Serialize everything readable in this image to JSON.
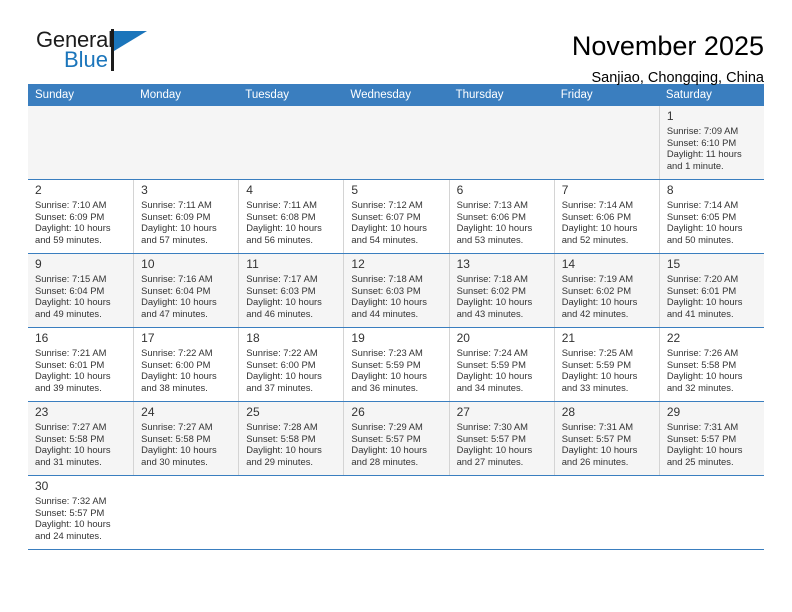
{
  "brand": {
    "name_top": "General",
    "name_bottom": "Blue",
    "flag_icon": "blue-flag-icon",
    "colors": {
      "blue": "#1b75bb",
      "black": "#1c1c1c"
    }
  },
  "header": {
    "title": "November 2025",
    "subtitle": "Sanjiao, Chongqing, China"
  },
  "calendar": {
    "header_background": "#3a7ebf",
    "weekdays": [
      "Sunday",
      "Monday",
      "Tuesday",
      "Wednesday",
      "Thursday",
      "Friday",
      "Saturday"
    ],
    "weeks": [
      [
        {
          "day": "",
          "sunrise": "",
          "sunset": "",
          "daylight_1": "",
          "daylight_2": ""
        },
        {
          "day": "",
          "sunrise": "",
          "sunset": "",
          "daylight_1": "",
          "daylight_2": ""
        },
        {
          "day": "",
          "sunrise": "",
          "sunset": "",
          "daylight_1": "",
          "daylight_2": ""
        },
        {
          "day": "",
          "sunrise": "",
          "sunset": "",
          "daylight_1": "",
          "daylight_2": ""
        },
        {
          "day": "",
          "sunrise": "",
          "sunset": "",
          "daylight_1": "",
          "daylight_2": ""
        },
        {
          "day": "",
          "sunrise": "",
          "sunset": "",
          "daylight_1": "",
          "daylight_2": ""
        },
        {
          "day": "1",
          "sunrise": "Sunrise: 7:09 AM",
          "sunset": "Sunset: 6:10 PM",
          "daylight_1": "Daylight: 11 hours",
          "daylight_2": "and 1 minute."
        }
      ],
      [
        {
          "day": "2",
          "sunrise": "Sunrise: 7:10 AM",
          "sunset": "Sunset: 6:09 PM",
          "daylight_1": "Daylight: 10 hours",
          "daylight_2": "and 59 minutes."
        },
        {
          "day": "3",
          "sunrise": "Sunrise: 7:11 AM",
          "sunset": "Sunset: 6:09 PM",
          "daylight_1": "Daylight: 10 hours",
          "daylight_2": "and 57 minutes."
        },
        {
          "day": "4",
          "sunrise": "Sunrise: 7:11 AM",
          "sunset": "Sunset: 6:08 PM",
          "daylight_1": "Daylight: 10 hours",
          "daylight_2": "and 56 minutes."
        },
        {
          "day": "5",
          "sunrise": "Sunrise: 7:12 AM",
          "sunset": "Sunset: 6:07 PM",
          "daylight_1": "Daylight: 10 hours",
          "daylight_2": "and 54 minutes."
        },
        {
          "day": "6",
          "sunrise": "Sunrise: 7:13 AM",
          "sunset": "Sunset: 6:06 PM",
          "daylight_1": "Daylight: 10 hours",
          "daylight_2": "and 53 minutes."
        },
        {
          "day": "7",
          "sunrise": "Sunrise: 7:14 AM",
          "sunset": "Sunset: 6:06 PM",
          "daylight_1": "Daylight: 10 hours",
          "daylight_2": "and 52 minutes."
        },
        {
          "day": "8",
          "sunrise": "Sunrise: 7:14 AM",
          "sunset": "Sunset: 6:05 PM",
          "daylight_1": "Daylight: 10 hours",
          "daylight_2": "and 50 minutes."
        }
      ],
      [
        {
          "day": "9",
          "sunrise": "Sunrise: 7:15 AM",
          "sunset": "Sunset: 6:04 PM",
          "daylight_1": "Daylight: 10 hours",
          "daylight_2": "and 49 minutes."
        },
        {
          "day": "10",
          "sunrise": "Sunrise: 7:16 AM",
          "sunset": "Sunset: 6:04 PM",
          "daylight_1": "Daylight: 10 hours",
          "daylight_2": "and 47 minutes."
        },
        {
          "day": "11",
          "sunrise": "Sunrise: 7:17 AM",
          "sunset": "Sunset: 6:03 PM",
          "daylight_1": "Daylight: 10 hours",
          "daylight_2": "and 46 minutes."
        },
        {
          "day": "12",
          "sunrise": "Sunrise: 7:18 AM",
          "sunset": "Sunset: 6:03 PM",
          "daylight_1": "Daylight: 10 hours",
          "daylight_2": "and 44 minutes."
        },
        {
          "day": "13",
          "sunrise": "Sunrise: 7:18 AM",
          "sunset": "Sunset: 6:02 PM",
          "daylight_1": "Daylight: 10 hours",
          "daylight_2": "and 43 minutes."
        },
        {
          "day": "14",
          "sunrise": "Sunrise: 7:19 AM",
          "sunset": "Sunset: 6:02 PM",
          "daylight_1": "Daylight: 10 hours",
          "daylight_2": "and 42 minutes."
        },
        {
          "day": "15",
          "sunrise": "Sunrise: 7:20 AM",
          "sunset": "Sunset: 6:01 PM",
          "daylight_1": "Daylight: 10 hours",
          "daylight_2": "and 41 minutes."
        }
      ],
      [
        {
          "day": "16",
          "sunrise": "Sunrise: 7:21 AM",
          "sunset": "Sunset: 6:01 PM",
          "daylight_1": "Daylight: 10 hours",
          "daylight_2": "and 39 minutes."
        },
        {
          "day": "17",
          "sunrise": "Sunrise: 7:22 AM",
          "sunset": "Sunset: 6:00 PM",
          "daylight_1": "Daylight: 10 hours",
          "daylight_2": "and 38 minutes."
        },
        {
          "day": "18",
          "sunrise": "Sunrise: 7:22 AM",
          "sunset": "Sunset: 6:00 PM",
          "daylight_1": "Daylight: 10 hours",
          "daylight_2": "and 37 minutes."
        },
        {
          "day": "19",
          "sunrise": "Sunrise: 7:23 AM",
          "sunset": "Sunset: 5:59 PM",
          "daylight_1": "Daylight: 10 hours",
          "daylight_2": "and 36 minutes."
        },
        {
          "day": "20",
          "sunrise": "Sunrise: 7:24 AM",
          "sunset": "Sunset: 5:59 PM",
          "daylight_1": "Daylight: 10 hours",
          "daylight_2": "and 34 minutes."
        },
        {
          "day": "21",
          "sunrise": "Sunrise: 7:25 AM",
          "sunset": "Sunset: 5:59 PM",
          "daylight_1": "Daylight: 10 hours",
          "daylight_2": "and 33 minutes."
        },
        {
          "day": "22",
          "sunrise": "Sunrise: 7:26 AM",
          "sunset": "Sunset: 5:58 PM",
          "daylight_1": "Daylight: 10 hours",
          "daylight_2": "and 32 minutes."
        }
      ],
      [
        {
          "day": "23",
          "sunrise": "Sunrise: 7:27 AM",
          "sunset": "Sunset: 5:58 PM",
          "daylight_1": "Daylight: 10 hours",
          "daylight_2": "and 31 minutes."
        },
        {
          "day": "24",
          "sunrise": "Sunrise: 7:27 AM",
          "sunset": "Sunset: 5:58 PM",
          "daylight_1": "Daylight: 10 hours",
          "daylight_2": "and 30 minutes."
        },
        {
          "day": "25",
          "sunrise": "Sunrise: 7:28 AM",
          "sunset": "Sunset: 5:58 PM",
          "daylight_1": "Daylight: 10 hours",
          "daylight_2": "and 29 minutes."
        },
        {
          "day": "26",
          "sunrise": "Sunrise: 7:29 AM",
          "sunset": "Sunset: 5:57 PM",
          "daylight_1": "Daylight: 10 hours",
          "daylight_2": "and 28 minutes."
        },
        {
          "day": "27",
          "sunrise": "Sunrise: 7:30 AM",
          "sunset": "Sunset: 5:57 PM",
          "daylight_1": "Daylight: 10 hours",
          "daylight_2": "and 27 minutes."
        },
        {
          "day": "28",
          "sunrise": "Sunrise: 7:31 AM",
          "sunset": "Sunset: 5:57 PM",
          "daylight_1": "Daylight: 10 hours",
          "daylight_2": "and 26 minutes."
        },
        {
          "day": "29",
          "sunrise": "Sunrise: 7:31 AM",
          "sunset": "Sunset: 5:57 PM",
          "daylight_1": "Daylight: 10 hours",
          "daylight_2": "and 25 minutes."
        }
      ],
      [
        {
          "day": "30",
          "sunrise": "Sunrise: 7:32 AM",
          "sunset": "Sunset: 5:57 PM",
          "daylight_1": "Daylight: 10 hours",
          "daylight_2": "and 24 minutes."
        },
        {
          "day": "",
          "sunrise": "",
          "sunset": "",
          "daylight_1": "",
          "daylight_2": ""
        },
        {
          "day": "",
          "sunrise": "",
          "sunset": "",
          "daylight_1": "",
          "daylight_2": ""
        },
        {
          "day": "",
          "sunrise": "",
          "sunset": "",
          "daylight_1": "",
          "daylight_2": ""
        },
        {
          "day": "",
          "sunrise": "",
          "sunset": "",
          "daylight_1": "",
          "daylight_2": ""
        },
        {
          "day": "",
          "sunrise": "",
          "sunset": "",
          "daylight_1": "",
          "daylight_2": ""
        },
        {
          "day": "",
          "sunrise": "",
          "sunset": "",
          "daylight_1": "",
          "daylight_2": ""
        }
      ]
    ]
  }
}
